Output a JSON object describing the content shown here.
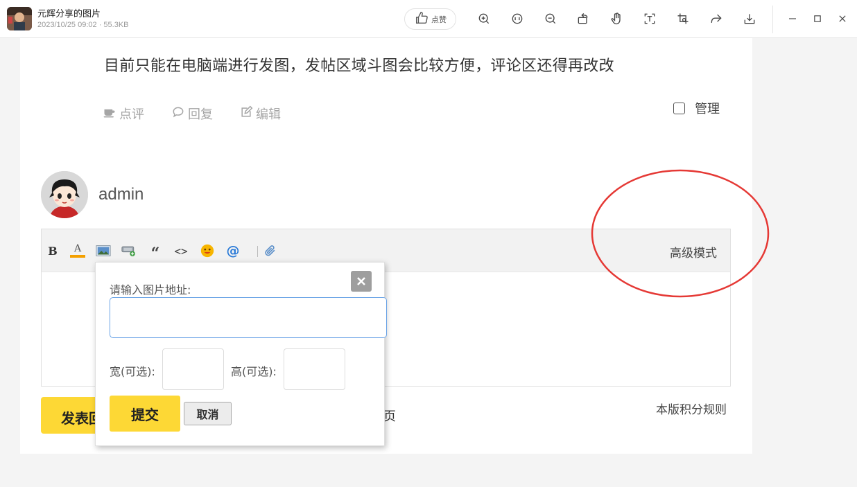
{
  "viewer": {
    "title": "元辉分享的图片",
    "meta": "2023/10/25 09:02 · 55.3KB",
    "like_label": "点赞",
    "icons": [
      "zoom-in-icon",
      "actual-size-icon",
      "zoom-out-icon",
      "rotate-icon",
      "hand-icon",
      "text-recognize-icon",
      "crop-icon",
      "share-icon",
      "download-icon"
    ],
    "window_controls": [
      "minimize-icon",
      "maximize-icon",
      "close-icon"
    ]
  },
  "post": {
    "text": "目前只能在电脑端进行发图，发帖区域斗图会比较方便，评论区还得再改改",
    "actions": {
      "comment": "点评",
      "reply": "回复",
      "edit": "编辑"
    },
    "manage_label": "管理"
  },
  "user": {
    "name": "admin"
  },
  "editor": {
    "toolbar_icons": [
      "bold-icon",
      "font-color-icon",
      "image-icon",
      "attach-image-icon",
      "quote-icon",
      "code-icon",
      "emoji-icon",
      "at-icon",
      "attachment-icon"
    ],
    "bold_glyph": "B",
    "color_glyph": "A",
    "quote_glyph": "“",
    "code_glyph": "<>",
    "at_glyph": "@",
    "advanced_label": "高级模式"
  },
  "image_popup": {
    "url_label": "请输入图片地址:",
    "url_value": "",
    "width_label": "宽(可选):",
    "height_label": "高(可选):",
    "width_value": "",
    "height_value": "",
    "submit_label": "提交",
    "cancel_label": "取消"
  },
  "footer": {
    "submit_label": "发表回复",
    "page_fragment": "页",
    "rules_label": "本版积分规则"
  },
  "colors": {
    "accent": "#fdd835",
    "focus": "#6aa3e6",
    "annotation": "#e53935"
  }
}
